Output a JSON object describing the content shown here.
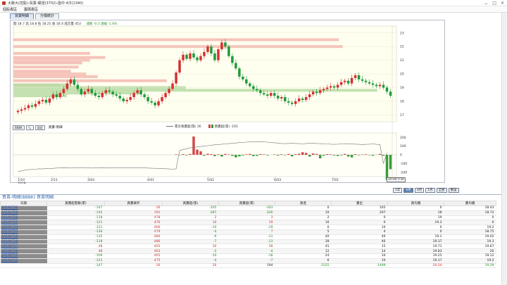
{
  "window": {
    "title": "大聯大(控股)-買賣-權證(3702)-盤中 4/5(1340)",
    "controls": [
      "－",
      "□",
      "×"
    ]
  },
  "menu": [
    "個股專區",
    "籌碼專區"
  ],
  "tabs": [
    {
      "label": "買賣明細"
    },
    {
      "label": "分價統計"
    }
  ],
  "quote": {
    "text": "開 18.7  高 18.8  低 18.25  收 18.4  成交量 453",
    "change": "漲跌 -0.3  漲幅 -1.6%"
  },
  "price_axis": [
    "23",
    "22",
    "21",
    "20",
    "19",
    "18",
    "17"
  ],
  "sub_axis": [
    "200",
    "100",
    "0",
    "-100",
    "-200"
  ],
  "date_axis": [
    "1/10\n2019",
    "2/11",
    "3/04",
    "4/01",
    "5/02",
    "6/03",
    "7/01"
  ],
  "toolbar": {
    "symbol": "BBBK",
    "search": "🔍",
    "settings": "設定",
    "label": "買賣-明細"
  },
  "legend": {
    "line_label": "累計買賣超(張) 26",
    "bar_label": "買賣超(張) -165"
  },
  "date_tag": "2019/7/30",
  "zoom": [
    "1年",
    "6月",
    "3月",
    "1月",
    "全部",
    "重設"
  ],
  "panel_title": "買賣-明細(BBBK) 買賣明細",
  "table": {
    "headers": [
      "日期",
      "買賣超張數(累)",
      "買賣庫存",
      "買賣超(張)",
      "買賣超(累)",
      "買進",
      "賣出",
      "買均價",
      "賣均價"
    ],
    "rows": [
      [
        "20190730",
        "-147",
        "26",
        "-165",
        "-303",
        "0",
        "165",
        "0",
        "18.43"
      ],
      [
        "20190729",
        "-142",
        "191",
        "-287",
        "-326",
        "10",
        "297",
        "18",
        "18.72"
      ],
      [
        "20190726",
        "-118",
        "478",
        "2",
        "3",
        "2",
        "0",
        "19",
        "0"
      ],
      [
        "20190725",
        "-121",
        "476",
        "10",
        "19",
        "10",
        "0",
        "19.3",
        "0"
      ],
      [
        "20190724",
        "-121",
        "466",
        "-10",
        "-19",
        "0",
        "10",
        "0",
        "19.2"
      ],
      [
        "20190723",
        "-136",
        "479",
        "-4",
        "7",
        "5",
        "4",
        "0",
        "18.75"
      ],
      [
        "20190719",
        "-135",
        "480",
        "-6",
        "-11",
        "40",
        "46",
        "19.1",
        "19.02"
      ],
      [
        "20190718",
        "-118",
        "486",
        "-7",
        "-13",
        "39",
        "46",
        "19.37",
        "19.3"
      ],
      [
        "20190717",
        "48",
        "493",
        "30",
        "58",
        "45",
        "15",
        "19.71",
        "19.87"
      ],
      [
        "20190716",
        "48",
        "463",
        "-2",
        "-4",
        "12",
        "14",
        "19.83",
        "20"
      ],
      [
        "20190715",
        "-109",
        "465",
        "-10",
        "-18",
        "24",
        "34",
        "19.25",
        "19.12"
      ],
      [
        "20190712",
        "-121",
        "475",
        "-4",
        "-7",
        "6",
        "10",
        "19.17",
        "19.2"
      ]
    ],
    "total": [
      "",
      "-147",
      "26",
      "26",
      "194",
      "1525",
      "1499",
      "20.24",
      "19.29"
    ]
  },
  "chart_data": {
    "type": "candlestick",
    "title": "",
    "ylim": [
      16.5,
      23.5
    ],
    "y_ticks": [
      17,
      18,
      19,
      20,
      21,
      22,
      23
    ],
    "sub_ylim": [
      -250,
      250
    ],
    "closes": [
      17.3,
      17.4,
      17.5,
      17.7,
      17.6,
      17.8,
      18.0,
      18.1,
      17.9,
      18.2,
      18.5,
      18.3,
      18.6,
      18.9,
      19.3,
      19.6,
      19.2,
      18.9,
      18.5,
      18.7,
      18.9,
      18.6,
      18.4,
      18.3,
      18.6,
      18.8,
      18.7,
      18.5,
      18.4,
      18.2,
      18.0,
      18.1,
      18.3,
      18.6,
      18.8,
      18.5,
      18.3,
      18.0,
      17.9,
      17.7,
      18.0,
      18.3,
      18.6,
      18.9,
      19.3,
      20.1,
      21.0,
      21.4,
      21.1,
      21.5,
      21.2,
      21.0,
      21.3,
      21.6,
      22.0,
      21.5,
      21.0,
      21.8,
      22.3,
      22.0,
      21.3,
      20.8,
      20.4,
      19.8,
      19.6,
      19.3,
      19.1,
      18.9,
      18.8,
      18.6,
      18.5,
      18.4,
      18.6,
      18.4,
      18.2,
      18.3,
      18.0,
      17.9,
      17.8,
      18.0,
      18.2,
      18.1,
      18.3,
      18.5,
      18.7,
      18.6,
      18.8,
      18.9,
      19.0,
      19.1,
      19.0,
      19.2,
      19.4,
      19.5,
      19.3,
      19.7,
      19.9,
      19.6,
      19.5,
      19.4,
      19.3,
      19.2,
      19.1,
      19.2,
      19.0,
      18.7,
      18.4
    ],
    "volume_profile": [
      {
        "price": 22.5,
        "buy": 0.85,
        "sell": 0
      },
      {
        "price": 22.0,
        "buy": 0.86,
        "sell": 0
      },
      {
        "price": 21.5,
        "buy": 0.2,
        "sell": 0
      },
      {
        "price": 21.2,
        "buy": 0.24,
        "sell": 0
      },
      {
        "price": 21.0,
        "buy": 0.2,
        "sell": 0
      },
      {
        "price": 20.8,
        "buy": 0.18,
        "sell": 0
      },
      {
        "price": 20.5,
        "buy": 0.17,
        "sell": 0
      },
      {
        "price": 20.2,
        "buy": 0.15,
        "sell": 0
      },
      {
        "price": 20.0,
        "buy": 0.19,
        "sell": 0
      },
      {
        "price": 19.8,
        "buy": 0.22,
        "sell": 0
      },
      {
        "price": 19.5,
        "buy": 0.4,
        "sell": 0
      },
      {
        "price": 19.2,
        "buy": 0.12,
        "sell": 0.15
      },
      {
        "price": 19.0,
        "buy": 0,
        "sell": 0.45
      },
      {
        "price": 18.8,
        "buy": 0,
        "sell": 0.95
      },
      {
        "price": 18.6,
        "buy": 0,
        "sell": 0.33
      },
      {
        "price": 18.4,
        "buy": 0,
        "sell": 0.14
      }
    ],
    "net_bars": [
      0,
      0,
      0,
      0,
      0,
      0,
      0,
      0,
      0,
      0,
      0,
      0,
      0,
      0,
      0,
      0,
      0,
      0,
      0,
      0,
      0,
      0,
      0,
      0,
      0,
      0,
      0,
      0,
      0,
      0,
      0,
      0,
      0,
      0,
      0,
      0,
      0,
      0,
      0,
      0,
      0,
      0,
      0,
      0,
      0,
      5,
      -4,
      8,
      -6,
      10,
      210,
      60,
      40,
      -10,
      12,
      8,
      -15,
      6,
      -20,
      10,
      5,
      -12,
      -30,
      -18,
      -8,
      6,
      10,
      -15,
      -12,
      8,
      5,
      -6,
      0,
      5,
      -8,
      6,
      -5,
      10,
      -18,
      7,
      12,
      30,
      22,
      -20,
      15,
      10,
      -40,
      -10,
      8,
      6,
      -7,
      -12,
      -6,
      10,
      -20,
      -30,
      8,
      -5,
      4,
      6,
      -4,
      -10,
      2,
      10,
      -10,
      -287,
      -165
    ],
    "cum_line": [
      -190,
      -185,
      -175,
      -170,
      -168,
      -165,
      -160,
      -162,
      -158,
      -160,
      -155,
      -152,
      -150,
      -148,
      -150,
      -152,
      -150,
      -148,
      -146,
      -148,
      -150,
      -152,
      -150,
      -150,
      -148,
      -150,
      -152,
      -150,
      -150,
      -150,
      -150,
      -150,
      -150,
      -150,
      -150,
      -150,
      -150,
      -152,
      -154,
      -155,
      -156,
      -158,
      -160,
      -162,
      -165,
      -160,
      50,
      60,
      70,
      80,
      85,
      90,
      95,
      100,
      105,
      110,
      115,
      118,
      122,
      125,
      128,
      132,
      135,
      140,
      142,
      145,
      148,
      150,
      152,
      150,
      148,
      145,
      140,
      138,
      135,
      130,
      128,
      130,
      132,
      130,
      128,
      125,
      130,
      132,
      135,
      130,
      128,
      126,
      125,
      122,
      120,
      122,
      125,
      128,
      126,
      124,
      122,
      120,
      118,
      120,
      122,
      125,
      120,
      118,
      -100,
      26
    ]
  }
}
